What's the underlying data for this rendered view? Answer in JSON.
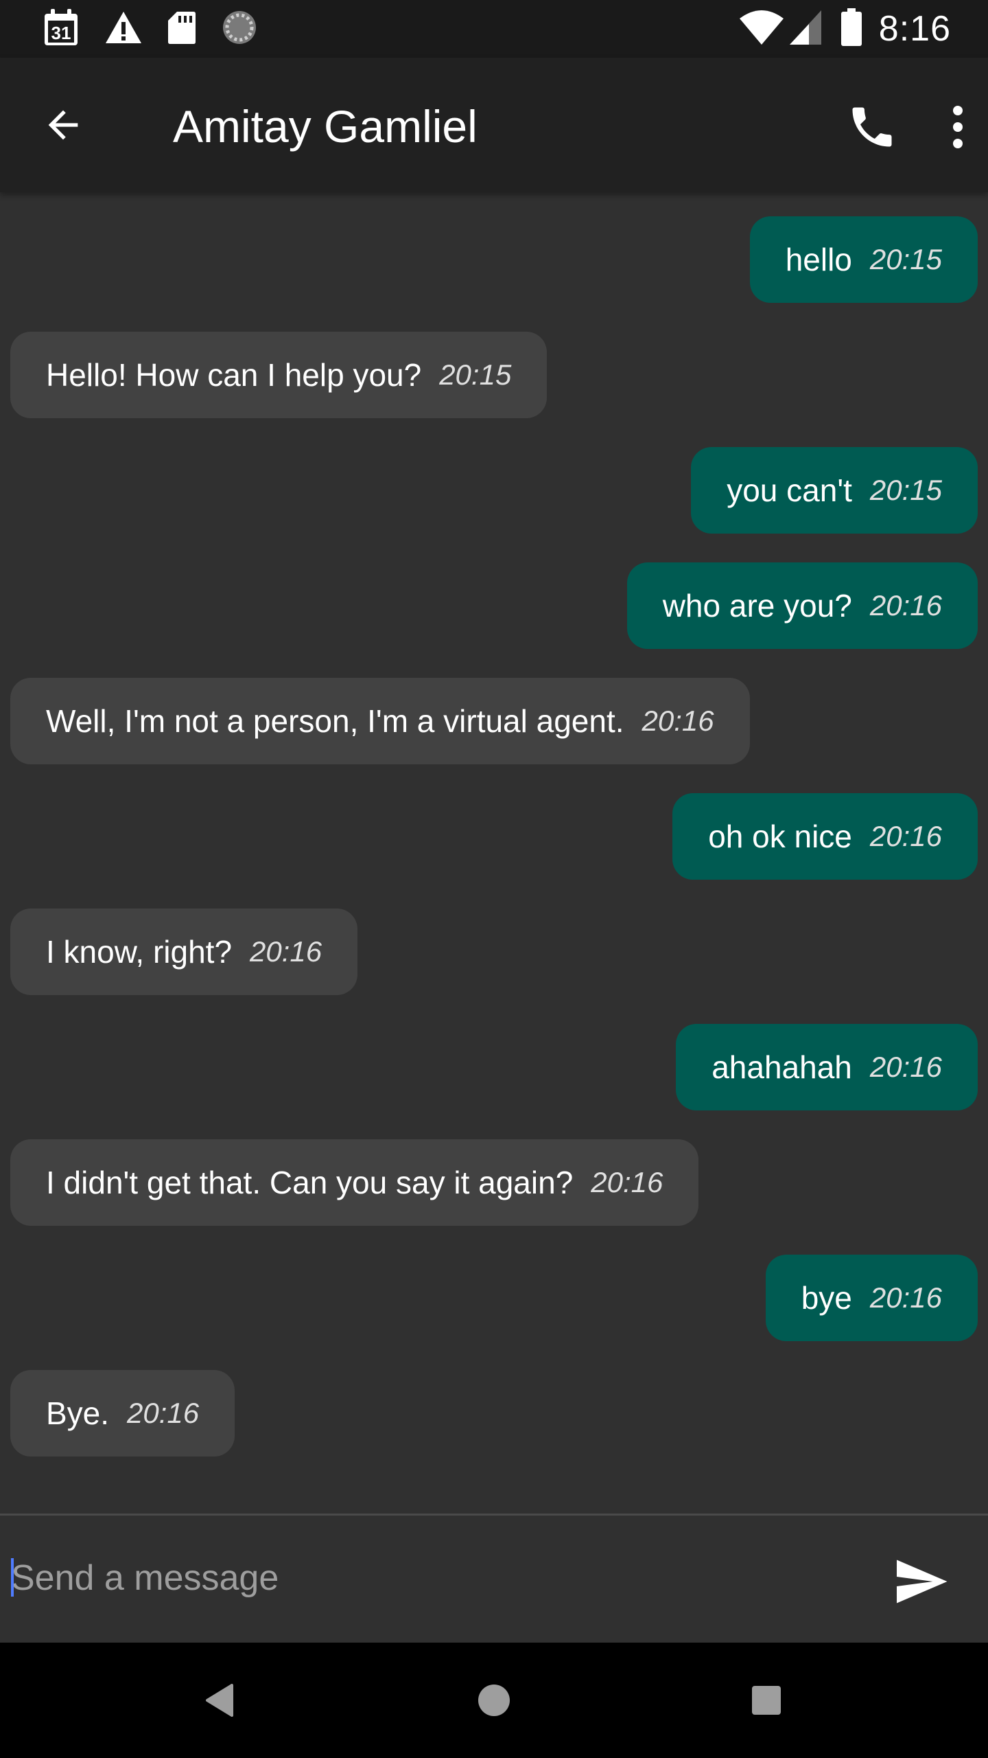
{
  "status_bar": {
    "time": "8:16",
    "icons_left": [
      "calendar-icon",
      "warning-icon",
      "sd-card-icon",
      "sync-icon"
    ],
    "calendar_day": "31",
    "icons_right": [
      "wifi-icon",
      "signal-icon",
      "battery-icon"
    ]
  },
  "app_bar": {
    "title": "Amitay Gamliel",
    "back_icon": "arrow-back-icon",
    "call_icon": "phone-icon",
    "more_icon": "more-vert-icon"
  },
  "messages": [
    {
      "direction": "sent",
      "text": "hello",
      "time": "20:15"
    },
    {
      "direction": "received",
      "text": "Hello! How can I help you?",
      "time": "20:15"
    },
    {
      "direction": "sent",
      "text": "you can't",
      "time": "20:15"
    },
    {
      "direction": "sent",
      "text": "who are you?",
      "time": "20:16"
    },
    {
      "direction": "received",
      "text": "Well, I'm not a person, I'm a virtual agent.",
      "time": "20:16"
    },
    {
      "direction": "sent",
      "text": "oh ok nice",
      "time": "20:16"
    },
    {
      "direction": "received",
      "text": "I know, right?",
      "time": "20:16"
    },
    {
      "direction": "sent",
      "text": "ahahahah",
      "time": "20:16"
    },
    {
      "direction": "received",
      "text": "I didn't get that. Can you say it again?",
      "time": "20:16"
    },
    {
      "direction": "sent",
      "text": "bye",
      "time": "20:16"
    },
    {
      "direction": "received",
      "text": "Bye.",
      "time": "20:16"
    }
  ],
  "composer": {
    "placeholder": "Send a message",
    "value": "",
    "send_icon": "send-icon"
  },
  "nav_bar": {
    "icons": [
      "back-triangle-icon",
      "home-circle-icon",
      "recents-square-icon"
    ]
  },
  "colors": {
    "sent_bubble": "#005b52",
    "received_bubble": "#424242",
    "background": "#303030",
    "app_bar": "#212121"
  }
}
